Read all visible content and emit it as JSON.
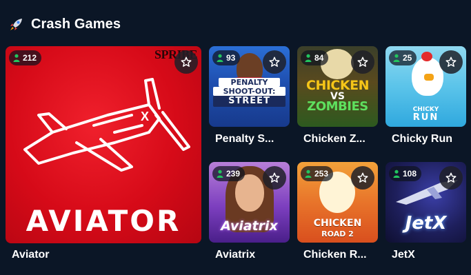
{
  "section": {
    "title": "Crash Games"
  },
  "games": [
    {
      "name": "Aviator",
      "players": "212",
      "logo_text": "AVIATOR",
      "corner_text": "SPRIBE"
    },
    {
      "name": "Penalty S...",
      "players": "93",
      "art_lines": [
        "PENALTY",
        "SHOOT-OUT:",
        "STREET"
      ]
    },
    {
      "name": "Chicken Z...",
      "players": "84",
      "art_lines": [
        "CHICKEN",
        "VS",
        "ZOMBIES"
      ]
    },
    {
      "name": "Chicky Run",
      "players": "25",
      "art_lines": [
        "CHICKY",
        "RUN"
      ]
    },
    {
      "name": "Aviatrix",
      "players": "239",
      "art_lines": [
        "Aviatrix"
      ]
    },
    {
      "name": "Chicken R...",
      "players": "253",
      "art_lines": [
        "CHICKEN",
        "ROAD 2"
      ]
    },
    {
      "name": "JetX",
      "players": "108",
      "art_lines": [
        "JetX"
      ]
    }
  ],
  "colors": {
    "background": "#0b1626",
    "aviator_red": "#e0101e",
    "online_green": "#22c55e"
  },
  "icons": {
    "section": "rocket-icon",
    "players": "person-icon",
    "favorite": "star-outline-icon"
  }
}
